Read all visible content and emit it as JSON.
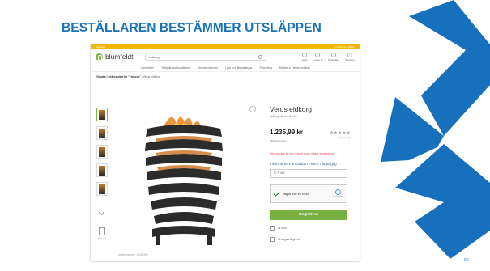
{
  "slide": {
    "title": "BESTÄLLAREN BESTÄMMER UTSLÄPPEN",
    "page_number": "60",
    "vertical_credit": "© Terano",
    "accent_color": "#1a73b8"
  },
  "shop": {
    "topbar_left": "blumfeldt",
    "topbar_right": "Fri frakt över 499 kr",
    "logo": "blumfeldt",
    "search_value": "eldkorg",
    "header_items": [
      "Hjälp",
      "Logga in",
      "Önskelista",
      "Varukorg"
    ],
    "nav_items": [
      "Utemöbler",
      "Trädgårdsdekorationer",
      "Terrassvärmare",
      "Ljus och Belysningar",
      "Planering",
      "Möbler & Heminredning"
    ],
    "breadcrumb_bold": "Tillbaka | Sökresultat för \"eldkorg\"",
    "breadcrumb_rest": "/ Verus eldkorg",
    "manual_label": "Manual",
    "article_no": "Artikelnummer: 10032999",
    "product_title": "Verus eldkorg",
    "product_subtitle": "eldkorg, 40 cm, 6,2 kg",
    "price": "1.235,99 kr",
    "stars": "★★★★★",
    "reviews_count": "Ingen betyg",
    "price_note": "Inklusive moms",
    "stock_message": "Denna vara är som i lager inom några arbetsdagar",
    "notify_text": "Informerar Eim Sådan Finns Tillgänglig",
    "email_placeholder": "E-mail",
    "captcha_label": "Jag är inte en robot",
    "captcha_brand": "reCAPTCHA",
    "register_button": "Registrera",
    "info_rows": [
      "Lil Kork",
      "60 dagars ångerrätt"
    ]
  }
}
